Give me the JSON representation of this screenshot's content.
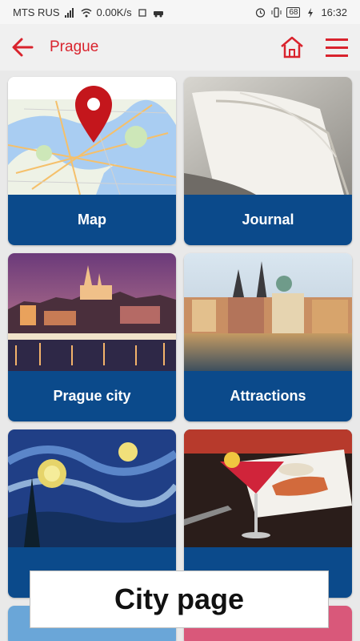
{
  "status_bar": {
    "carrier": "MTS RUS",
    "speed": "0.00K/s",
    "battery": "68",
    "time": "16:32"
  },
  "app_bar": {
    "title": "Prague",
    "back_icon": "arrow-left-icon",
    "home_icon": "home-icon",
    "menu_icon": "hamburger-menu-icon"
  },
  "colors": {
    "accent": "#d9232d",
    "card_label_bg": "#0b4a8b"
  },
  "cards": [
    {
      "label": "Map",
      "image": "map-image"
    },
    {
      "label": "Journal",
      "image": "open-book-image"
    },
    {
      "label": "Prague city",
      "image": "prague-castle-night-image"
    },
    {
      "label": "Attractions",
      "image": "old-town-riverside-image"
    },
    {
      "label": "",
      "image": "starry-night-painting-image"
    },
    {
      "label": "",
      "image": "cocktail-and-fish-dish-image"
    }
  ],
  "caption": "City page"
}
